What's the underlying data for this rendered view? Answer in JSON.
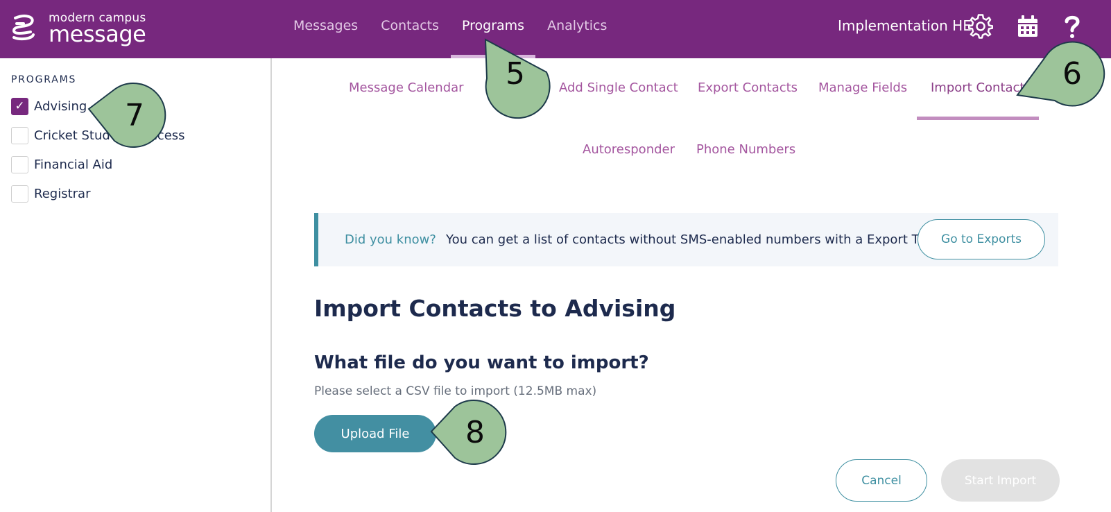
{
  "app": {
    "logo_top": "modern campus",
    "logo_bottom": "message"
  },
  "nav": {
    "items": [
      {
        "label": "Messages",
        "active": false
      },
      {
        "label": "Contacts",
        "active": false
      },
      {
        "label": "Programs",
        "active": true
      },
      {
        "label": "Analytics",
        "active": false
      }
    ]
  },
  "topbar": {
    "tenant": "Implementation HE",
    "icons": [
      "gear-icon",
      "calendar-icon",
      "help-icon"
    ]
  },
  "sidebar": {
    "title": "PROGRAMS",
    "items": [
      {
        "label": "Advising",
        "checked": true
      },
      {
        "label": "Cricket Student Success",
        "checked": false
      },
      {
        "label": "Financial Aid",
        "checked": false
      },
      {
        "label": "Registrar",
        "checked": false
      }
    ]
  },
  "subtabs": {
    "row1": [
      {
        "label": "Message Calendar"
      },
      {
        "label": "Add Single Contact"
      },
      {
        "label": "Export Contacts"
      },
      {
        "label": "Manage Fields"
      },
      {
        "label": "Import Contacts",
        "active": true
      }
    ],
    "row2": [
      {
        "label": "Autoresponder"
      },
      {
        "label": "Phone Numbers"
      }
    ]
  },
  "banner": {
    "question": "Did you know?",
    "text": "You can get a list of contacts without SMS-enabled numbers with a Export Tool.",
    "button": "Go to Exports"
  },
  "main": {
    "heading": "Import Contacts to Advising",
    "question": "What file do you want to import?",
    "hint": "Please select a CSV file to import (12.5MB max)",
    "upload_label": "Upload File",
    "cancel_label": "Cancel",
    "start_label": "Start Import"
  },
  "callouts": [
    {
      "number": "5"
    },
    {
      "number": "6"
    },
    {
      "number": "7"
    },
    {
      "number": "8"
    }
  ],
  "colors": {
    "brand": "#77287e",
    "accent": "#3e8fa1",
    "callout_fill": "#9dc49a",
    "callout_stroke": "#1d3a4a"
  }
}
